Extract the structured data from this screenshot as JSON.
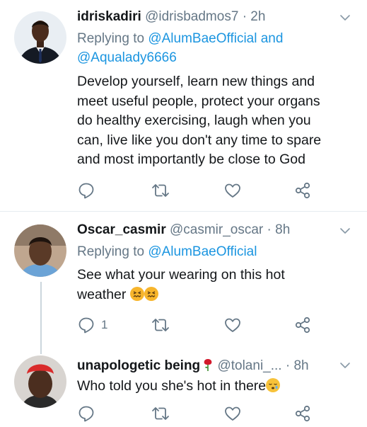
{
  "tweets": [
    {
      "name": "idriskadiri",
      "handle": "@idrisbadmos7",
      "time": "· 2h",
      "replying_prefix": "Replying to ",
      "replying_line1": "@AlumBaeOfficial and",
      "replying_line2": "@Aqualady6666",
      "body_lines": [
        "Develop yourself,  learn new things and",
        "meet useful people, protect your organs",
        "do healthy exercising, laugh when you",
        "can, live like you don't any time to spare",
        "and most importantly be close to God"
      ],
      "reply_count": ""
    },
    {
      "name": "Oscar_casmir",
      "handle": "@casmir_oscar",
      "time": "· 8h",
      "replying_prefix": "Replying to ",
      "replying_line1": "@AlumBaeOfficial",
      "body_lines": [
        "See what your wearing on this hot",
        "weather"
      ],
      "reply_count": "1"
    },
    {
      "name": "unapologetic being",
      "handle": "@tolani_...",
      "time": "· 8h",
      "body_lines": [
        "Who told you she's hot in there"
      ],
      "reply_count": ""
    }
  ],
  "icons": {
    "reply": "reply-icon",
    "retweet": "retweet-icon",
    "like": "heart-icon",
    "share": "share-icon",
    "more": "chevron-down-icon"
  },
  "colors": {
    "text": "#14171a",
    "secondary": "#657786",
    "link": "#1b95e0",
    "divider": "#e6ecf0"
  }
}
